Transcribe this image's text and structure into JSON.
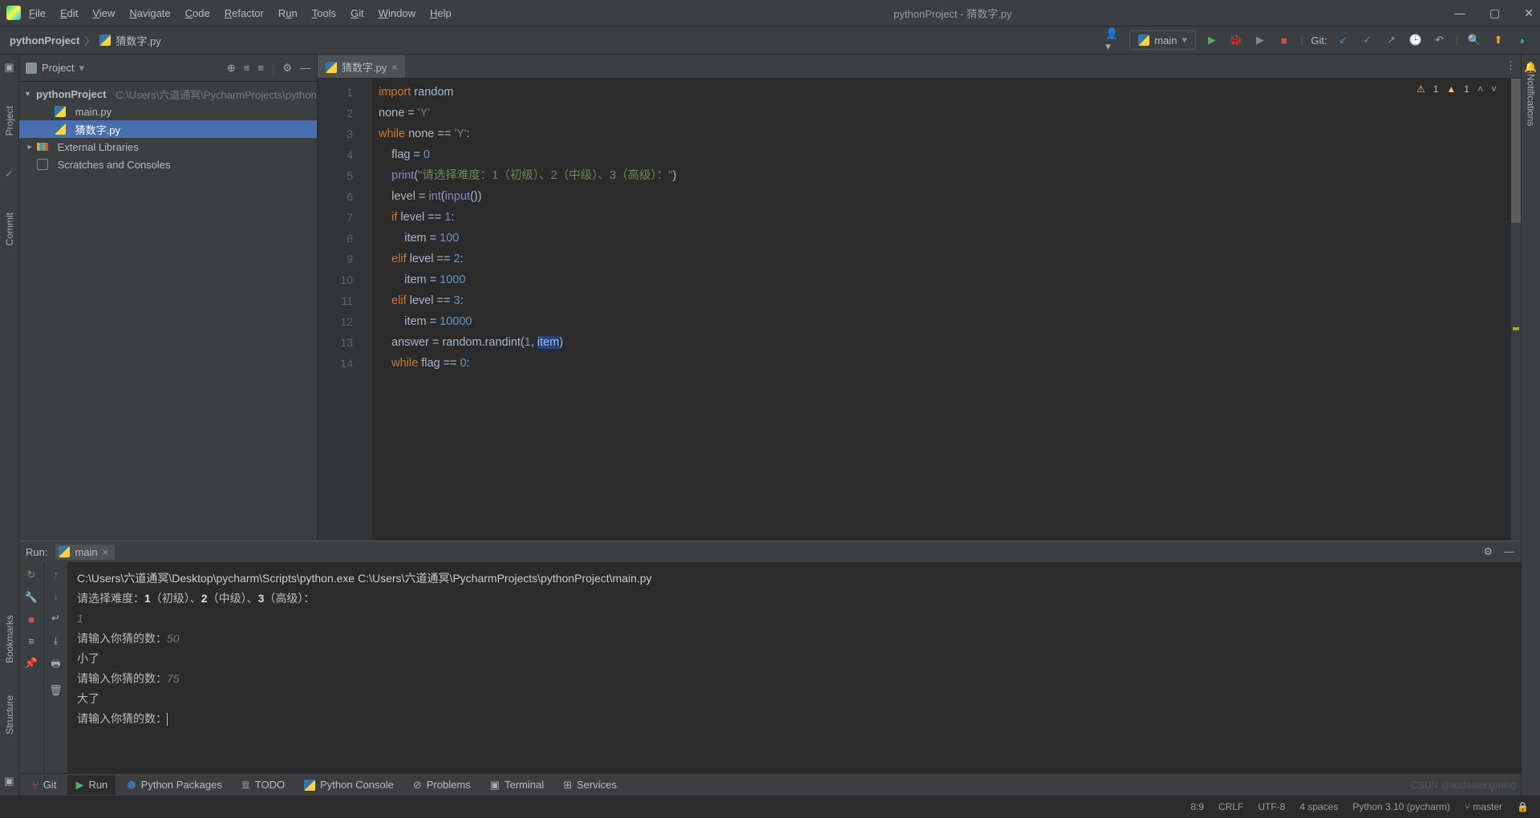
{
  "window": {
    "title": "pythonProject - 猜数字.py"
  },
  "menu": [
    "File",
    "Edit",
    "View",
    "Navigate",
    "Code",
    "Refactor",
    "Run",
    "Tools",
    "Git",
    "Window",
    "Help"
  ],
  "breadcrumb": {
    "project": "pythonProject",
    "file": "猜数字.py"
  },
  "run_config": {
    "name": "main"
  },
  "git_label": "Git:",
  "left_tabs": [
    "Project",
    "Commit"
  ],
  "left_tabs2": [
    "Bookmarks",
    "Structure"
  ],
  "right_tab": "Notifications",
  "project_pane": {
    "title": "Project",
    "root": {
      "name": "pythonProject",
      "path": "C:\\Users\\六道通冥\\PycharmProjects\\pythonProject"
    },
    "files": [
      "main.py",
      "猜数字.py"
    ],
    "ext_lib": "External Libraries",
    "scratches": "Scratches and Consoles"
  },
  "editor": {
    "tab": "猜数字.py",
    "warn1": "1",
    "warn2": "1",
    "lines": [
      {
        "n": 1,
        "html": "<span class='kw'>import</span> random"
      },
      {
        "n": 2,
        "html": "none = <span class='str'>'Y'</span>"
      },
      {
        "n": 3,
        "html": "<span class='kw'>while</span> none == <span class='str'>'Y'</span>:"
      },
      {
        "n": 4,
        "html": "    flag = <span class='num'>0</span>"
      },
      {
        "n": 5,
        "html": "    <span class='fn'>print</span>(<span class='str'>\"请选择难度：1（初级）、2（中级）、3（高级）：\"</span>)"
      },
      {
        "n": 6,
        "html": "    level = <span class='fn'>int</span>(<span class='fn'>input</span>())"
      },
      {
        "n": 7,
        "html": "    <span class='kw'>if</span> level == <span class='num'>1</span>:"
      },
      {
        "n": 8,
        "html": "        item = <span class='num'>100</span>"
      },
      {
        "n": 9,
        "html": "    <span class='kw'>elif</span> level == <span class='num'>2</span>:"
      },
      {
        "n": 10,
        "html": "        item = <span class='num'>1000</span>"
      },
      {
        "n": 11,
        "html": "    <span class='kw'>elif</span> level == <span class='num'>3</span>:"
      },
      {
        "n": 12,
        "html": "        item = <span class='num'>10000</span>"
      },
      {
        "n": 13,
        "html": "    answer = random.randint(<span class='num'>1</span>, <span class='hl'>item</span>)"
      },
      {
        "n": 14,
        "html": "    <span class='kw'>while</span> flag == <span class='num'>0</span>:"
      }
    ]
  },
  "run_panel": {
    "label": "Run:",
    "tab": "main",
    "cmd": "C:\\Users\\六道通冥\\Desktop\\pycharm\\Scripts\\python.exe C:\\Users\\六道通冥\\PycharmProjects\\pythonProject\\main.py",
    "l1a": "请选择难度：",
    "l1b": "1",
    "l1c": "（初级）、",
    "l1d": "2",
    "l1e": "（中级）、",
    "l1f": "3",
    "l1g": "（高级）：",
    "a1": "1",
    "l2": "请输入你猜的数：",
    "a2": "50",
    "l3": "小了",
    "l4": "请输入你猜的数：",
    "a4": "75",
    "l5": "大了",
    "l6": "请输入你猜的数："
  },
  "bottom_tabs": [
    "Git",
    "Run",
    "Python Packages",
    "TODO",
    "Python Console",
    "Problems",
    "Terminal",
    "Services"
  ],
  "watermark": "CSDN @liudaotongming",
  "status": {
    "pos": "8:9",
    "eol": "CRLF",
    "enc": "UTF-8",
    "indent": "4 spaces",
    "py": "Python 3.10 (pycharm)",
    "branch": "master"
  }
}
